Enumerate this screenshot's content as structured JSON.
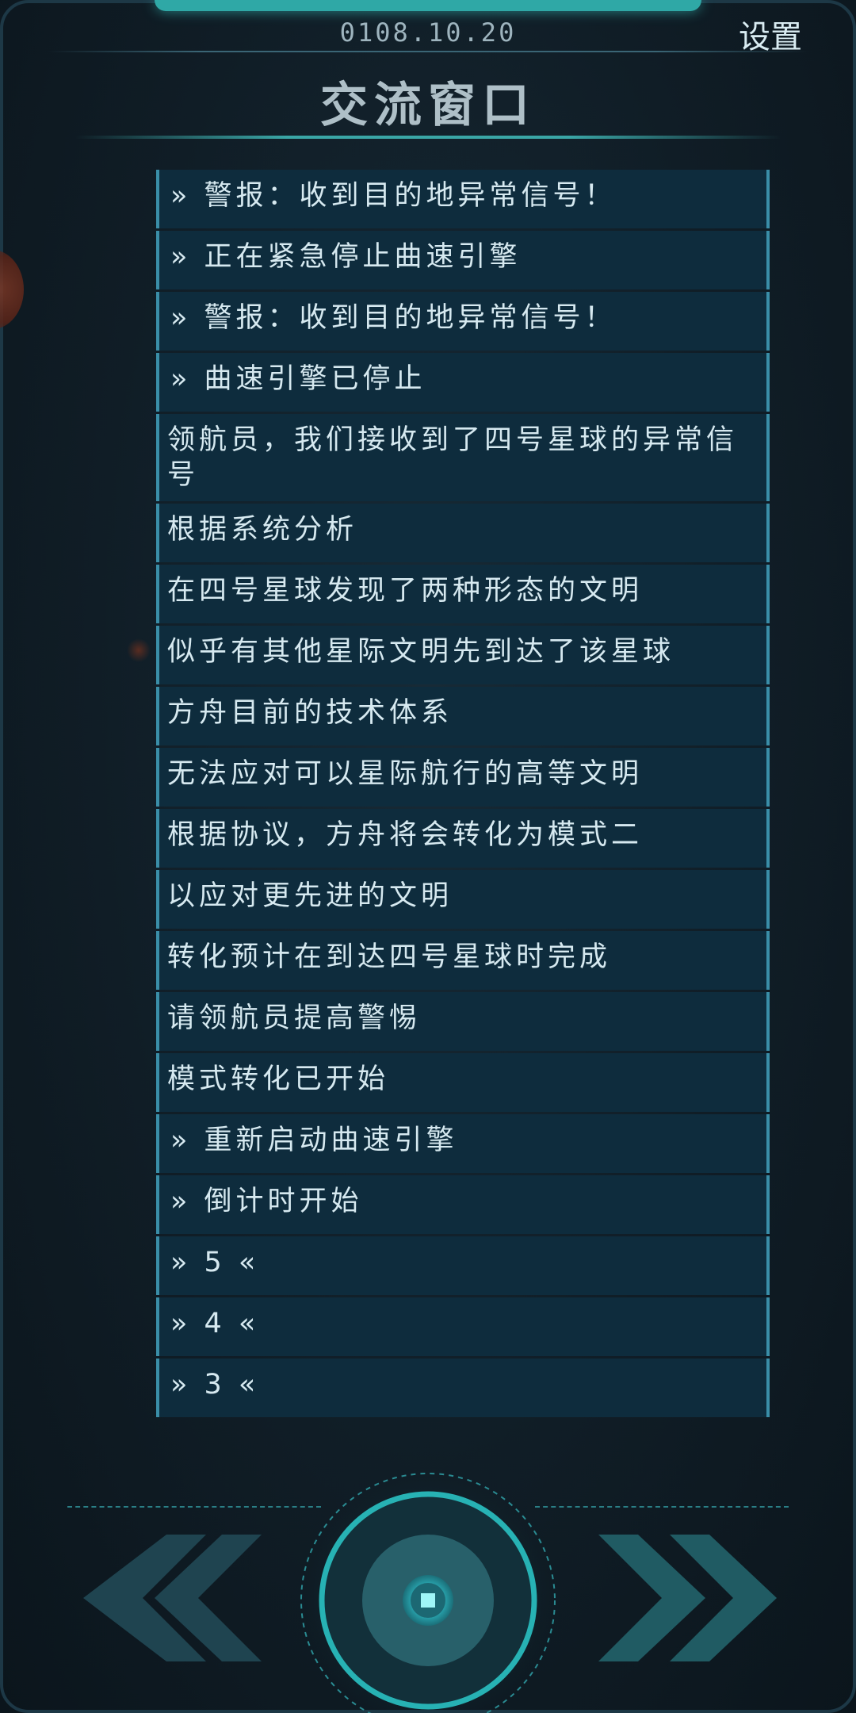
{
  "header": {
    "date": "0108.10.20",
    "settings_label": "设置",
    "title": "交流窗口"
  },
  "messages": [
    {
      "text": "» 警报：收到目的地异常信号！",
      "type": "system"
    },
    {
      "text": "» 正在紧急停止曲速引擎",
      "type": "system"
    },
    {
      "text": "» 警报：收到目的地异常信号！",
      "type": "system"
    },
    {
      "text": "» 曲速引擎已停止",
      "type": "system"
    },
    {
      "text": "领航员，我们接收到了四号星球的异常信号",
      "type": "dialog"
    },
    {
      "text": "根据系统分析",
      "type": "dialog"
    },
    {
      "text": "在四号星球发现了两种形态的文明",
      "type": "dialog"
    },
    {
      "text": "似乎有其他星际文明先到达了该星球",
      "type": "dialog"
    },
    {
      "text": "方舟目前的技术体系",
      "type": "dialog"
    },
    {
      "text": "无法应对可以星际航行的高等文明",
      "type": "dialog"
    },
    {
      "text": "根据协议，方舟将会转化为模式二",
      "type": "dialog"
    },
    {
      "text": "以应对更先进的文明",
      "type": "dialog"
    },
    {
      "text": "转化预计在到达四号星球时完成",
      "type": "dialog"
    },
    {
      "text": "请领航员提高警惕",
      "type": "dialog"
    },
    {
      "text": "模式转化已开始",
      "type": "dialog"
    },
    {
      "text": "» 重新启动曲速引擎",
      "type": "system"
    },
    {
      "text": "» 倒计时开始",
      "type": "system"
    },
    {
      "text": "» 5 «",
      "type": "system"
    },
    {
      "text": "» 4 «",
      "type": "system"
    },
    {
      "text": "» 3 «",
      "type": "system"
    }
  ],
  "controls": {
    "prev_icon": "double-chevron-left-icon",
    "next_icon": "double-chevron-right-icon",
    "center_icon": "dial-button-icon"
  },
  "colors": {
    "accent": "#2fb3b3",
    "panel": "#0e2c3d",
    "panel_border": "#3a8ea8",
    "text": "#d6e9f0",
    "background": "#101d26"
  }
}
